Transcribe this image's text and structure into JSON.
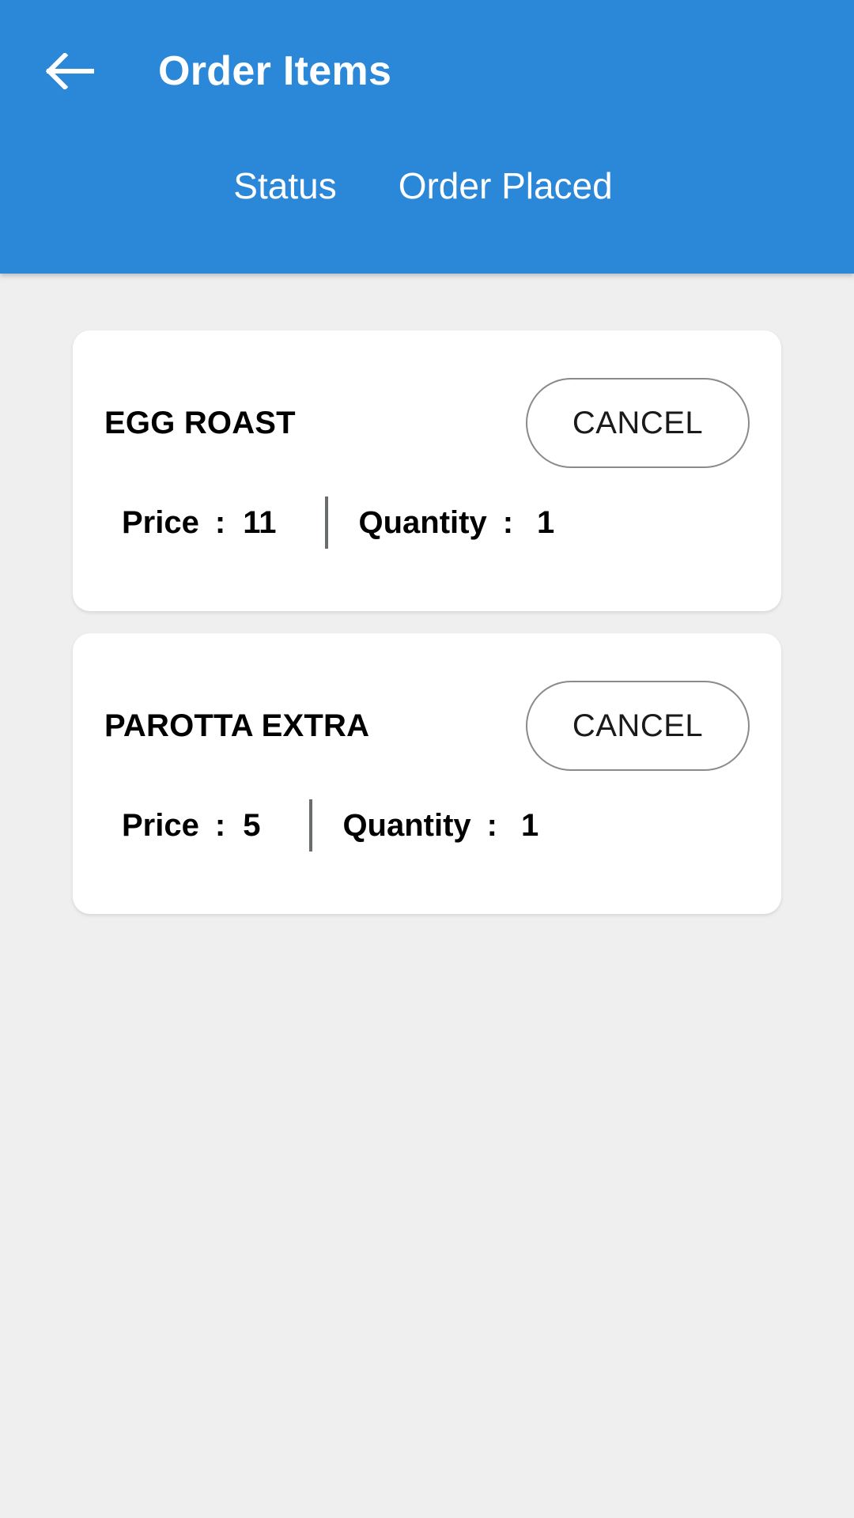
{
  "appbar": {
    "back_icon": "arrow-left-icon",
    "title": "Order Items",
    "status_label": "Status",
    "status_value": "Order Placed",
    "background_color": "#2b88d8",
    "text_color": "#ffffff"
  },
  "page": {
    "background_color": "#efefef"
  },
  "card_defaults": {
    "price_key": "Price",
    "quantity_key": "Quantity",
    "colon": ":",
    "cancel_label": "CANCEL"
  },
  "items": [
    {
      "name": "EGG ROAST",
      "cancel_label": "CANCEL",
      "price_key": "Price",
      "price_colon": ":",
      "price_value": "11",
      "quantity_key": "Quantity",
      "quantity_colon": ":",
      "quantity_value": "1"
    },
    {
      "name": "PAROTTA EXTRA",
      "cancel_label": "CANCEL",
      "price_key": "Price",
      "price_colon": ":",
      "price_value": "5",
      "quantity_key": "Quantity",
      "quantity_colon": ":",
      "quantity_value": "1"
    }
  ]
}
